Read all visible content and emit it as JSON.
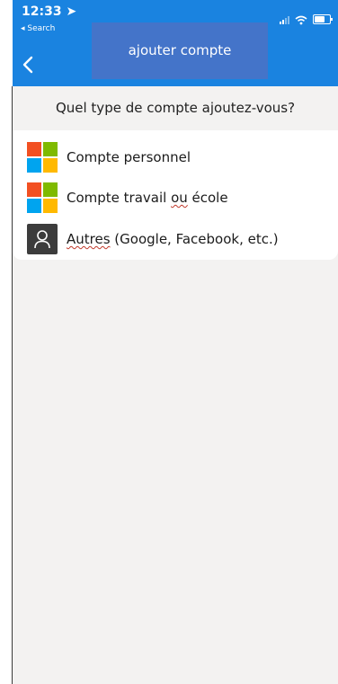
{
  "status_bar": {
    "time": "12:33 ➤",
    "back_app": "◂ Search",
    "battery_level": 0.7
  },
  "header": {
    "title": "ajouter compte",
    "back_icon": "chevron-left-icon",
    "background": "#1a83e0",
    "title_box_color": "#4474c9"
  },
  "question": "Quel type de compte ajoutez-vous?",
  "accounts": [
    {
      "label": "Compte personnel",
      "icon": "microsoft-logo-icon"
    },
    {
      "label_prefix": "Compte travail ",
      "label_underlined": "ou",
      "label_suffix": " école",
      "icon": "microsoft-logo-icon"
    },
    {
      "label_underlined": "Autres",
      "label_suffix": " (Google, Facebook, etc.)",
      "icon": "person-icon"
    }
  ],
  "colors": {
    "ms_red": "#f25022",
    "ms_green": "#7fba00",
    "ms_blue": "#00a4ef",
    "ms_yellow": "#ffb900"
  }
}
